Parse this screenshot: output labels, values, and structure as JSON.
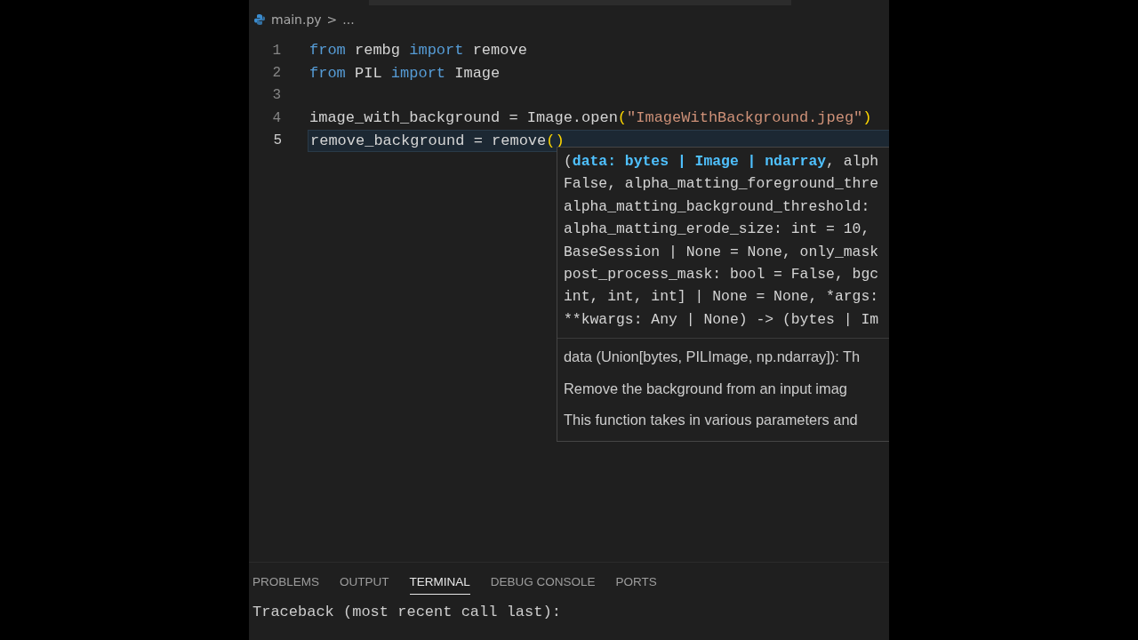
{
  "breadcrumb": {
    "file": "main.py",
    "separator": ">",
    "rest": "..."
  },
  "code_lines": [
    {
      "number": "1",
      "current": false,
      "tokens": [
        {
          "text": "from",
          "kind": "keyword"
        },
        {
          "text": " rembg ",
          "kind": "plain"
        },
        {
          "text": "import",
          "kind": "keyword"
        },
        {
          "text": " remove",
          "kind": "plain"
        }
      ]
    },
    {
      "number": "2",
      "current": false,
      "tokens": [
        {
          "text": "from",
          "kind": "keyword"
        },
        {
          "text": " PIL ",
          "kind": "plain"
        },
        {
          "text": "import",
          "kind": "keyword"
        },
        {
          "text": " Image",
          "kind": "plain"
        }
      ]
    },
    {
      "number": "3",
      "current": false
    },
    {
      "number": "4",
      "current": false,
      "tokens": [
        {
          "text": "image_with_background = Image.open",
          "kind": "plain"
        },
        {
          "text": "(",
          "kind": "bracket"
        },
        {
          "text": "\"ImageWithBackground.jpeg\"",
          "kind": "string"
        },
        {
          "text": ")",
          "kind": "bracket"
        }
      ]
    },
    {
      "number": "5",
      "current": true,
      "tokens": [
        {
          "text": "remove_background = remove",
          "kind": "plain"
        },
        {
          "text": "()",
          "kind": "bracket"
        }
      ]
    }
  ],
  "hover": {
    "signature": [
      [
        {
          "text": "(",
          "kind": "plain"
        },
        {
          "text": "data: bytes | Image | ndarray",
          "kind": "active"
        },
        {
          "text": ", alph",
          "kind": "plain"
        }
      ],
      [
        {
          "text": "False, alpha_matting_foreground_thre",
          "kind": "plain"
        }
      ],
      [
        {
          "text": "alpha_matting_background_threshold:",
          "kind": "plain"
        }
      ],
      [
        {
          "text": "alpha_matting_erode_size: int = 10,",
          "kind": "plain"
        }
      ],
      [
        {
          "text": "BaseSession | None = None, only_mask",
          "kind": "plain"
        }
      ],
      [
        {
          "text": "post_process_mask: bool = False, bgc",
          "kind": "plain"
        }
      ],
      [
        {
          "text": "int, int, int] | None = None, *args:",
          "kind": "plain"
        }
      ],
      [
        {
          "text": "**kwargs: Any | None) -> (bytes | Im",
          "kind": "plain"
        }
      ]
    ],
    "docs": [
      "data (Union[bytes, PILImage, np.ndarray]): Th",
      "Remove the background from an input imag",
      "This function takes in various parameters and"
    ]
  },
  "panel": {
    "tabs": [
      {
        "label": "PROBLEMS",
        "selected": false
      },
      {
        "label": "OUTPUT",
        "selected": false
      },
      {
        "label": "TERMINAL",
        "selected": true
      },
      {
        "label": "DEBUG CONSOLE",
        "selected": false
      },
      {
        "label": "PORTS",
        "selected": false
      }
    ],
    "terminal_lines": [
      "Traceback (most recent call last):"
    ]
  }
}
